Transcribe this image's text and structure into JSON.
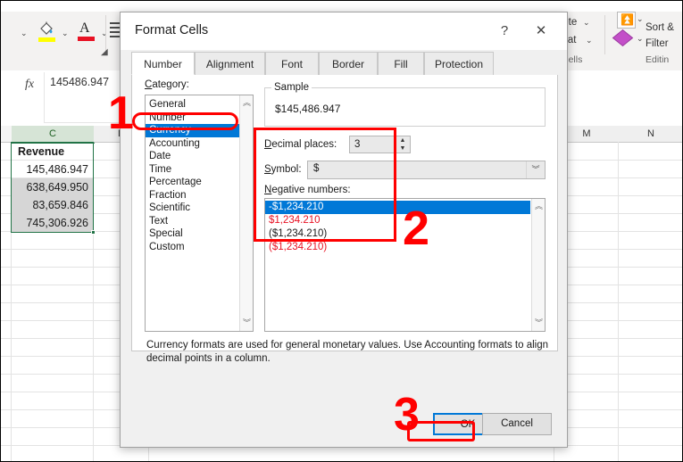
{
  "app": {
    "ribbon": {
      "fill_color_icon": "fill-color-icon",
      "font_color_icon": "font-color-icon",
      "align_icon": "align-left-icon",
      "dialog_launcher_icon": "dialog-launcher-icon",
      "delete_label": "Delete",
      "format_label": "Format",
      "cells_group_label": "Cells",
      "sort_label": "Sort &",
      "filter_label": "Filter",
      "editing_group_label": "Editin",
      "sort_filter_icon": "sort-filter-icon",
      "find_select_icon": "find-select-icon",
      "chevron": "⌄"
    },
    "formula_bar": {
      "fx_icon": "fx-icon",
      "value": "145486.947"
    },
    "grid": {
      "column_headers": [
        "C",
        "D",
        "M",
        "N"
      ],
      "cells": [
        {
          "text": "Revenue",
          "header": true,
          "selected": false
        },
        {
          "text": "145,486.947",
          "header": false,
          "selected": false
        },
        {
          "text": "638,649.950",
          "header": false,
          "selected": true
        },
        {
          "text": "83,659.846",
          "header": false,
          "selected": true
        },
        {
          "text": "745,306.926",
          "header": false,
          "selected": true
        }
      ],
      "selection_color": "#217346"
    }
  },
  "dialog": {
    "title": "Format Cells",
    "help_icon": "help-icon",
    "close_icon": "close-icon",
    "tabs": [
      {
        "label": "Number",
        "active": true
      },
      {
        "label": "Alignment",
        "active": false
      },
      {
        "label": "Font",
        "active": false
      },
      {
        "label": "Border",
        "active": false
      },
      {
        "label": "Fill",
        "active": false
      },
      {
        "label": "Protection",
        "active": false
      }
    ],
    "category": {
      "label": "Category:",
      "items": [
        {
          "label": "General",
          "selected": false
        },
        {
          "label": "Number",
          "selected": false
        },
        {
          "label": "Currency",
          "selected": true
        },
        {
          "label": "Accounting",
          "selected": false
        },
        {
          "label": "Date",
          "selected": false
        },
        {
          "label": "Time",
          "selected": false
        },
        {
          "label": "Percentage",
          "selected": false
        },
        {
          "label": "Fraction",
          "selected": false
        },
        {
          "label": "Scientific",
          "selected": false
        },
        {
          "label": "Text",
          "selected": false
        },
        {
          "label": "Special",
          "selected": false
        },
        {
          "label": "Custom",
          "selected": false
        }
      ],
      "scroll_up_icon": "chevron-up-icon",
      "scroll_down_icon": "chevron-down-icon"
    },
    "sample": {
      "legend": "Sample",
      "value": "$145,486.947"
    },
    "decimal_places": {
      "label": "Decimal places:",
      "value": "3",
      "spin_up_icon": "spinner-up-icon",
      "spin_down_icon": "spinner-down-icon"
    },
    "symbol": {
      "label": "Symbol:",
      "value": "$",
      "dropdown_icon": "chevron-down-icon"
    },
    "negative_numbers": {
      "label": "Negative numbers:",
      "items": [
        {
          "text": "-$1,234.210",
          "selected": true,
          "red": false
        },
        {
          "text": "$1,234.210",
          "selected": false,
          "red": true
        },
        {
          "text": "($1,234.210)",
          "selected": false,
          "red": false
        },
        {
          "text": "($1,234.210)",
          "selected": false,
          "red": true
        }
      ],
      "scroll_up_icon": "chevron-up-icon",
      "scroll_down_icon": "chevron-down-icon"
    },
    "description": "Currency formats are used for general monetary values.  Use Accounting formats to align decimal points in a column.",
    "buttons": {
      "ok": "OK",
      "cancel": "Cancel"
    }
  },
  "annotations": {
    "accent_color": "#ff0000",
    "steps": [
      {
        "number": "1"
      },
      {
        "number": "2"
      },
      {
        "number": "3"
      }
    ]
  }
}
